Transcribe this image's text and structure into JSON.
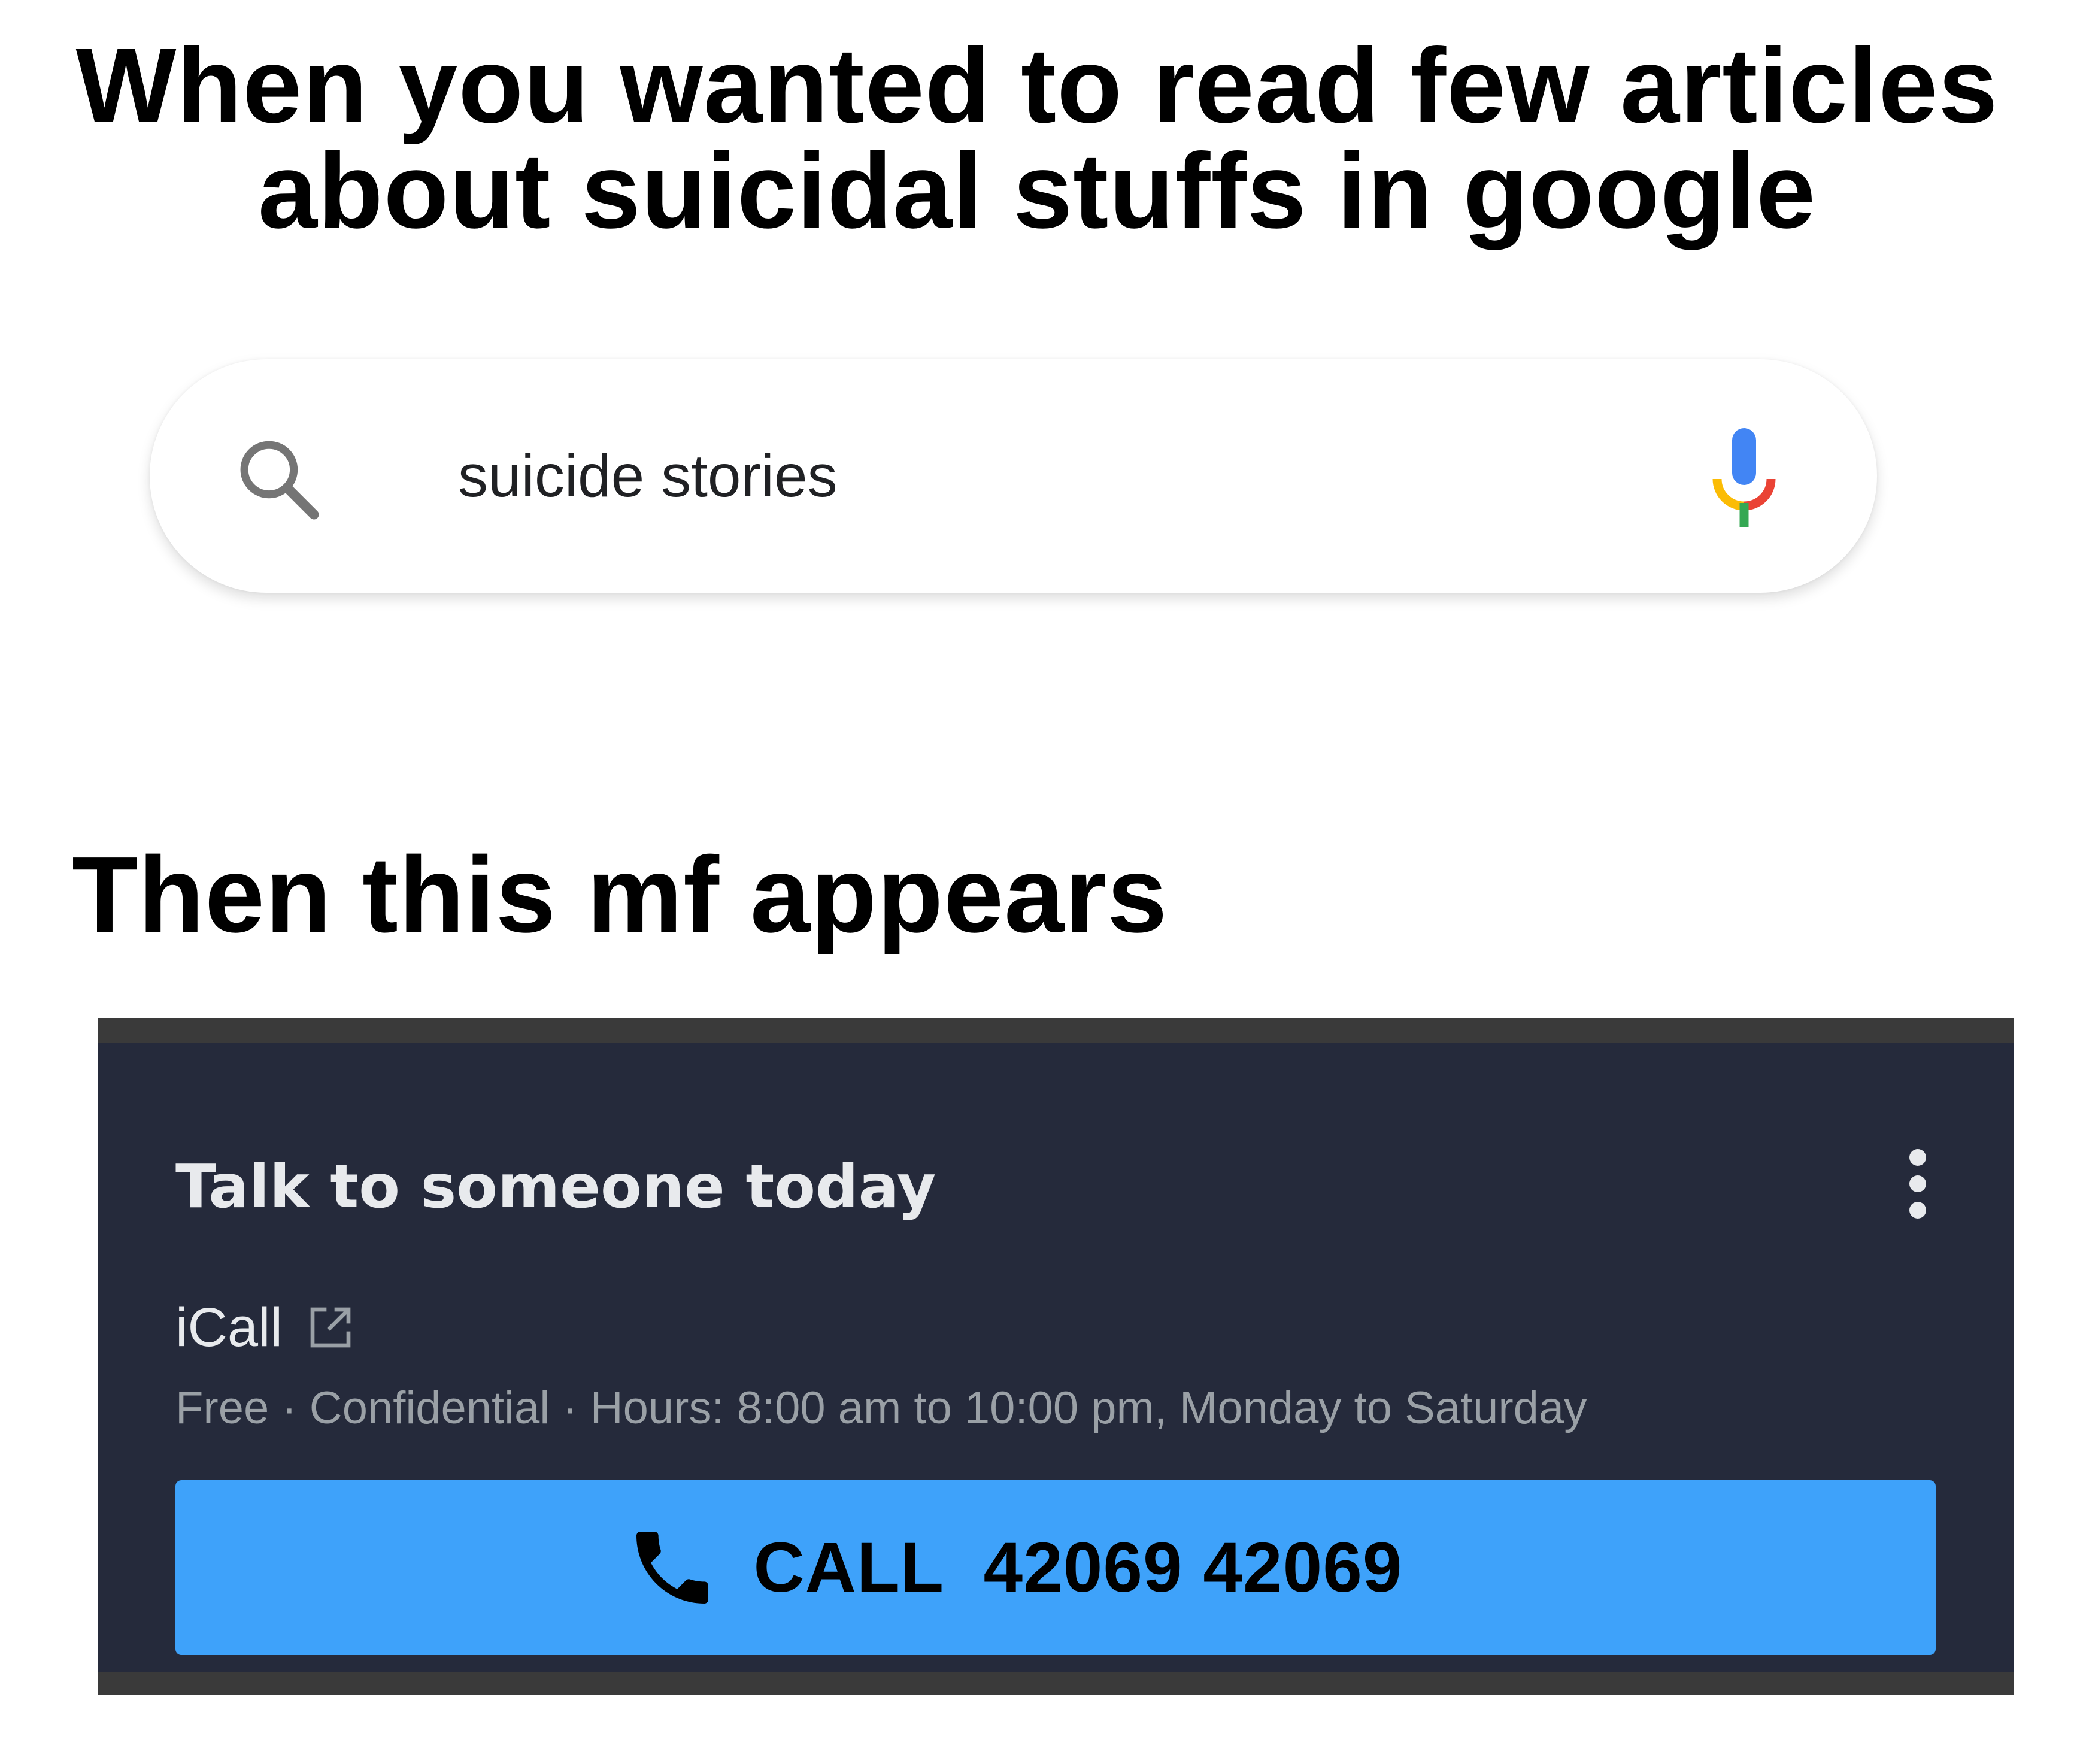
{
  "caption_top": {
    "line1": "When you wanted to read few articles",
    "line2": "about suicidal stuffs in google"
  },
  "search": {
    "query": "suicide stories",
    "leading_icon": "search-icon",
    "trailing_icon": "microphone-icon",
    "mic_colors": [
      "#4285f4",
      "#ea4335",
      "#fbbc05",
      "#34a853"
    ]
  },
  "caption_middle": "Then this mf appears",
  "helpline_card": {
    "title": "Talk to someone today",
    "menu_icon": "more-vertical-icon",
    "provider": {
      "name": "iCall",
      "link_icon": "external-link-icon",
      "details": "Free · Confidential · Hours: 8:00 am to 10:00 pm, Monday to Saturday"
    },
    "call_button": {
      "icon": "phone-icon",
      "label": "CALL  42069 42069"
    },
    "colors": {
      "background": "#252a3b",
      "button": "#3ea2fa"
    }
  }
}
